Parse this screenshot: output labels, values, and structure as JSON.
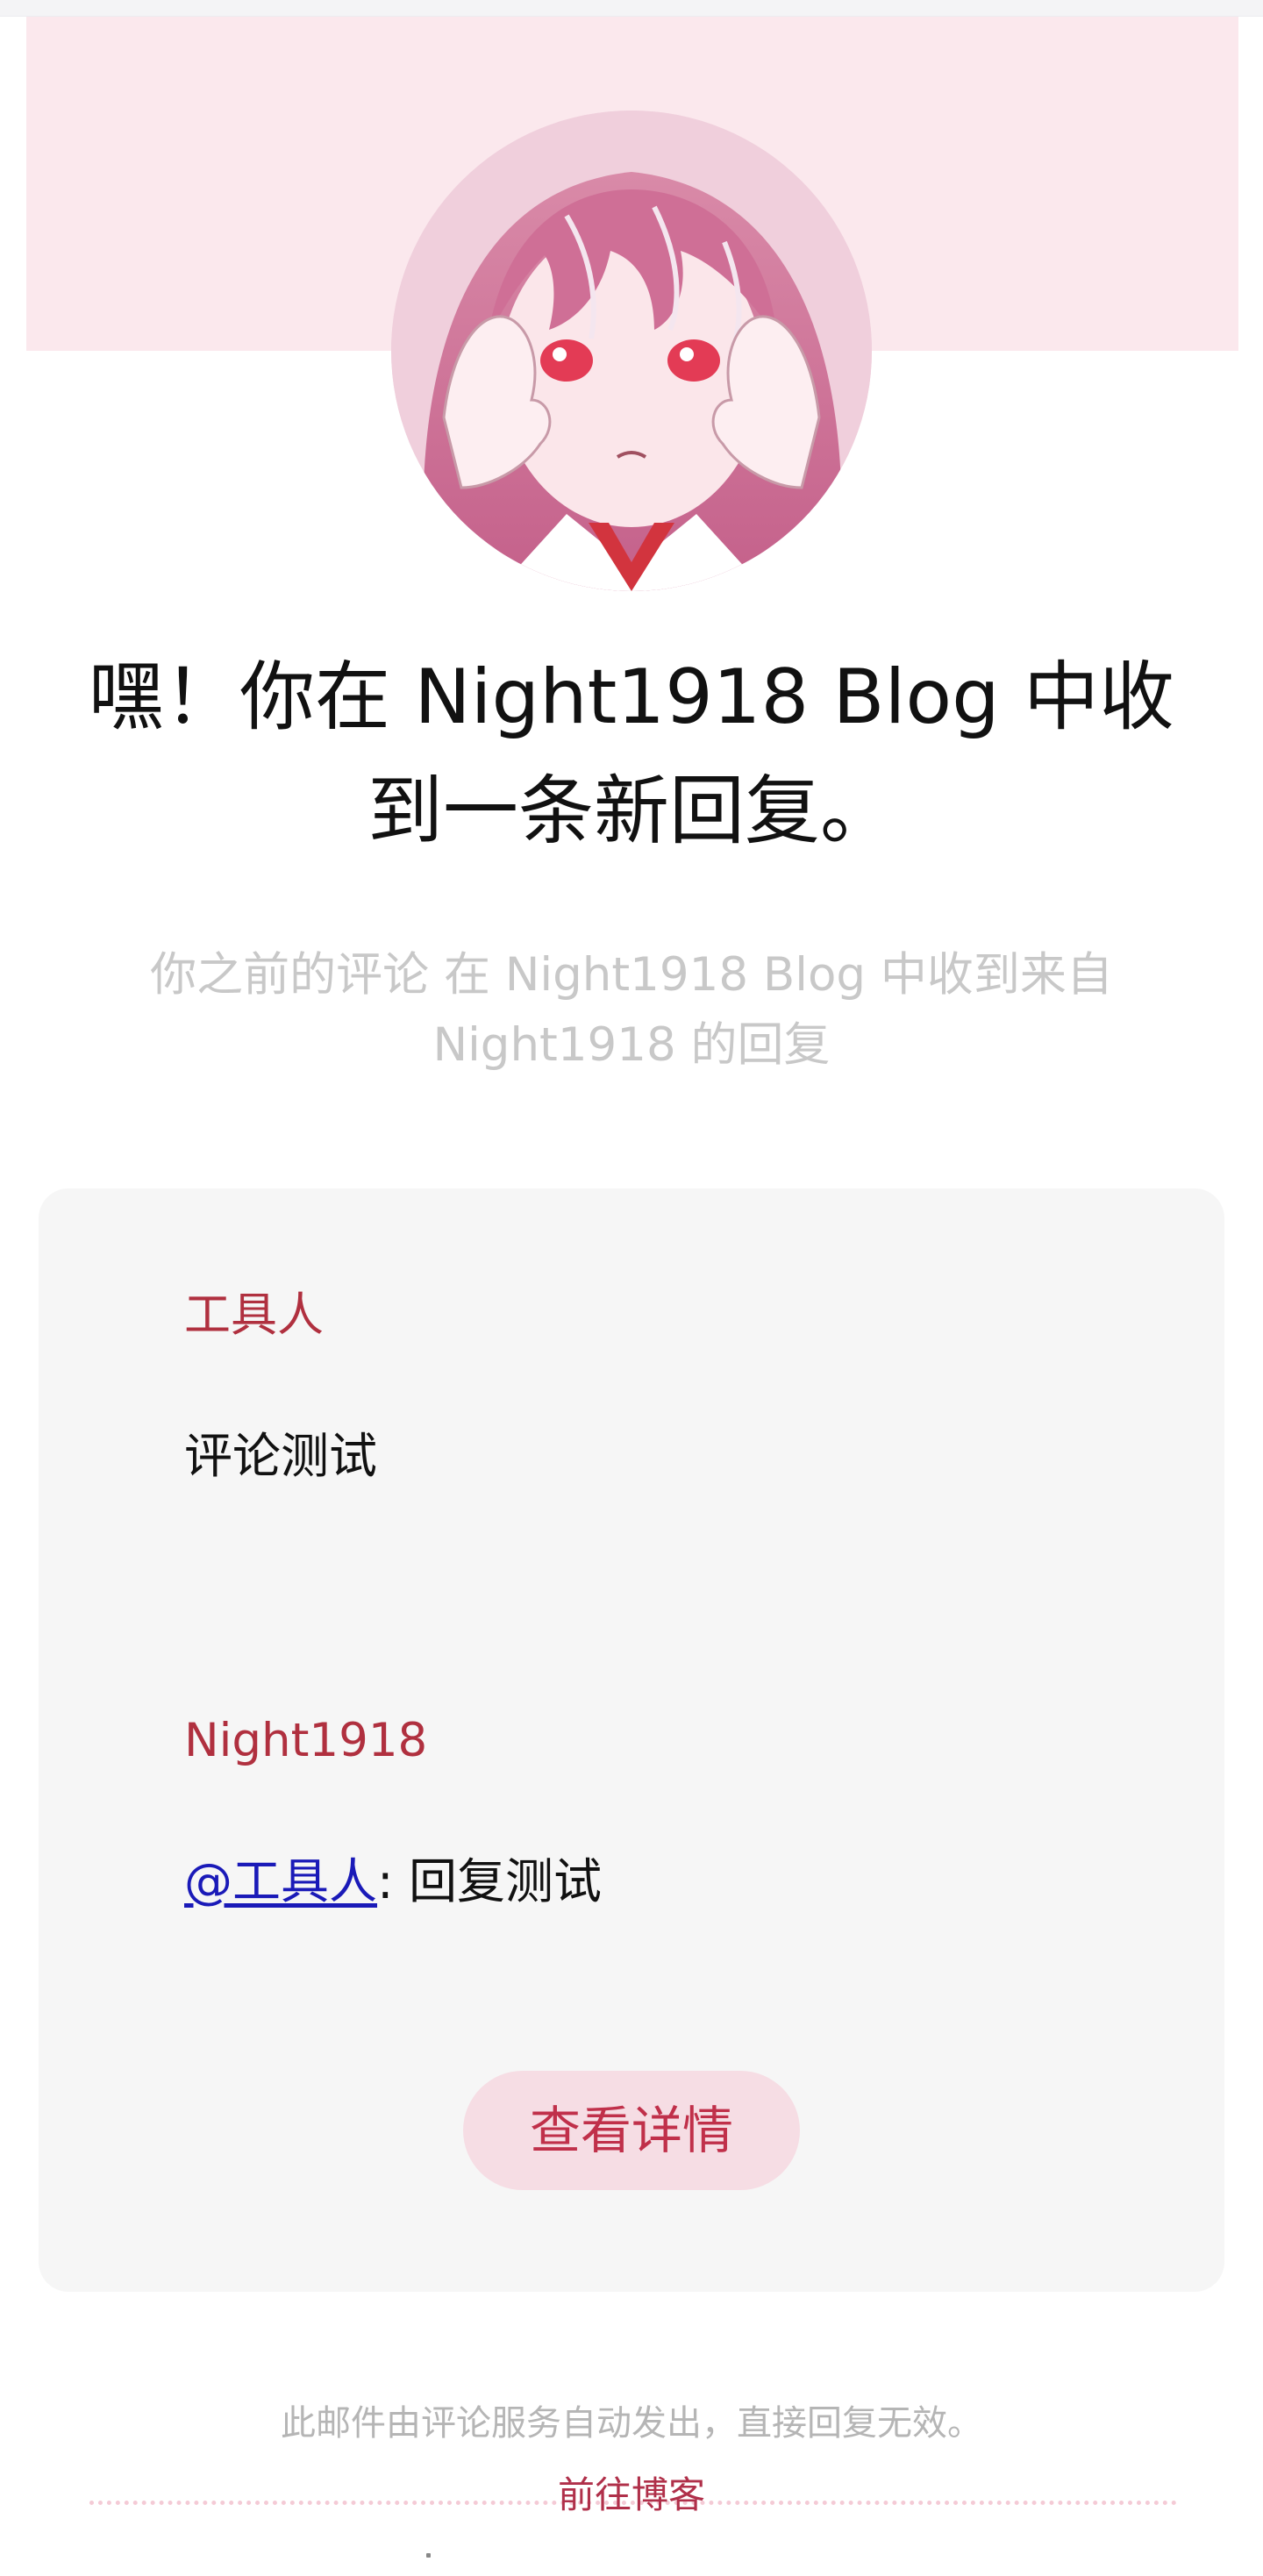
{
  "email": {
    "headline": "嘿！你在 Night1918 Blog 中收到一条新回复。",
    "subline": "你之前的评论 在 Night1918 Blog 中收到来自 Night1918 的回复",
    "original_comment": {
      "author": "工具人",
      "text": "评论测试"
    },
    "reply": {
      "author": "Night1918",
      "mention": "@工具人",
      "separator": ": ",
      "text": "回复测试"
    },
    "details_button": "查看详情",
    "footer_note": "此邮件由评论服务自动发出，直接回复无效。",
    "footer_link": "前往博客"
  },
  "avatar": {
    "icon": "anime-girl-avatar",
    "background_color": "#f3d3df"
  },
  "colors": {
    "header_band": "#fbe8ed",
    "author_name": "#b0303f",
    "button_background": "#f6dde4",
    "button_text": "#c0304a",
    "card_background": "#f6f6f6",
    "link": "#1a1ab8"
  }
}
